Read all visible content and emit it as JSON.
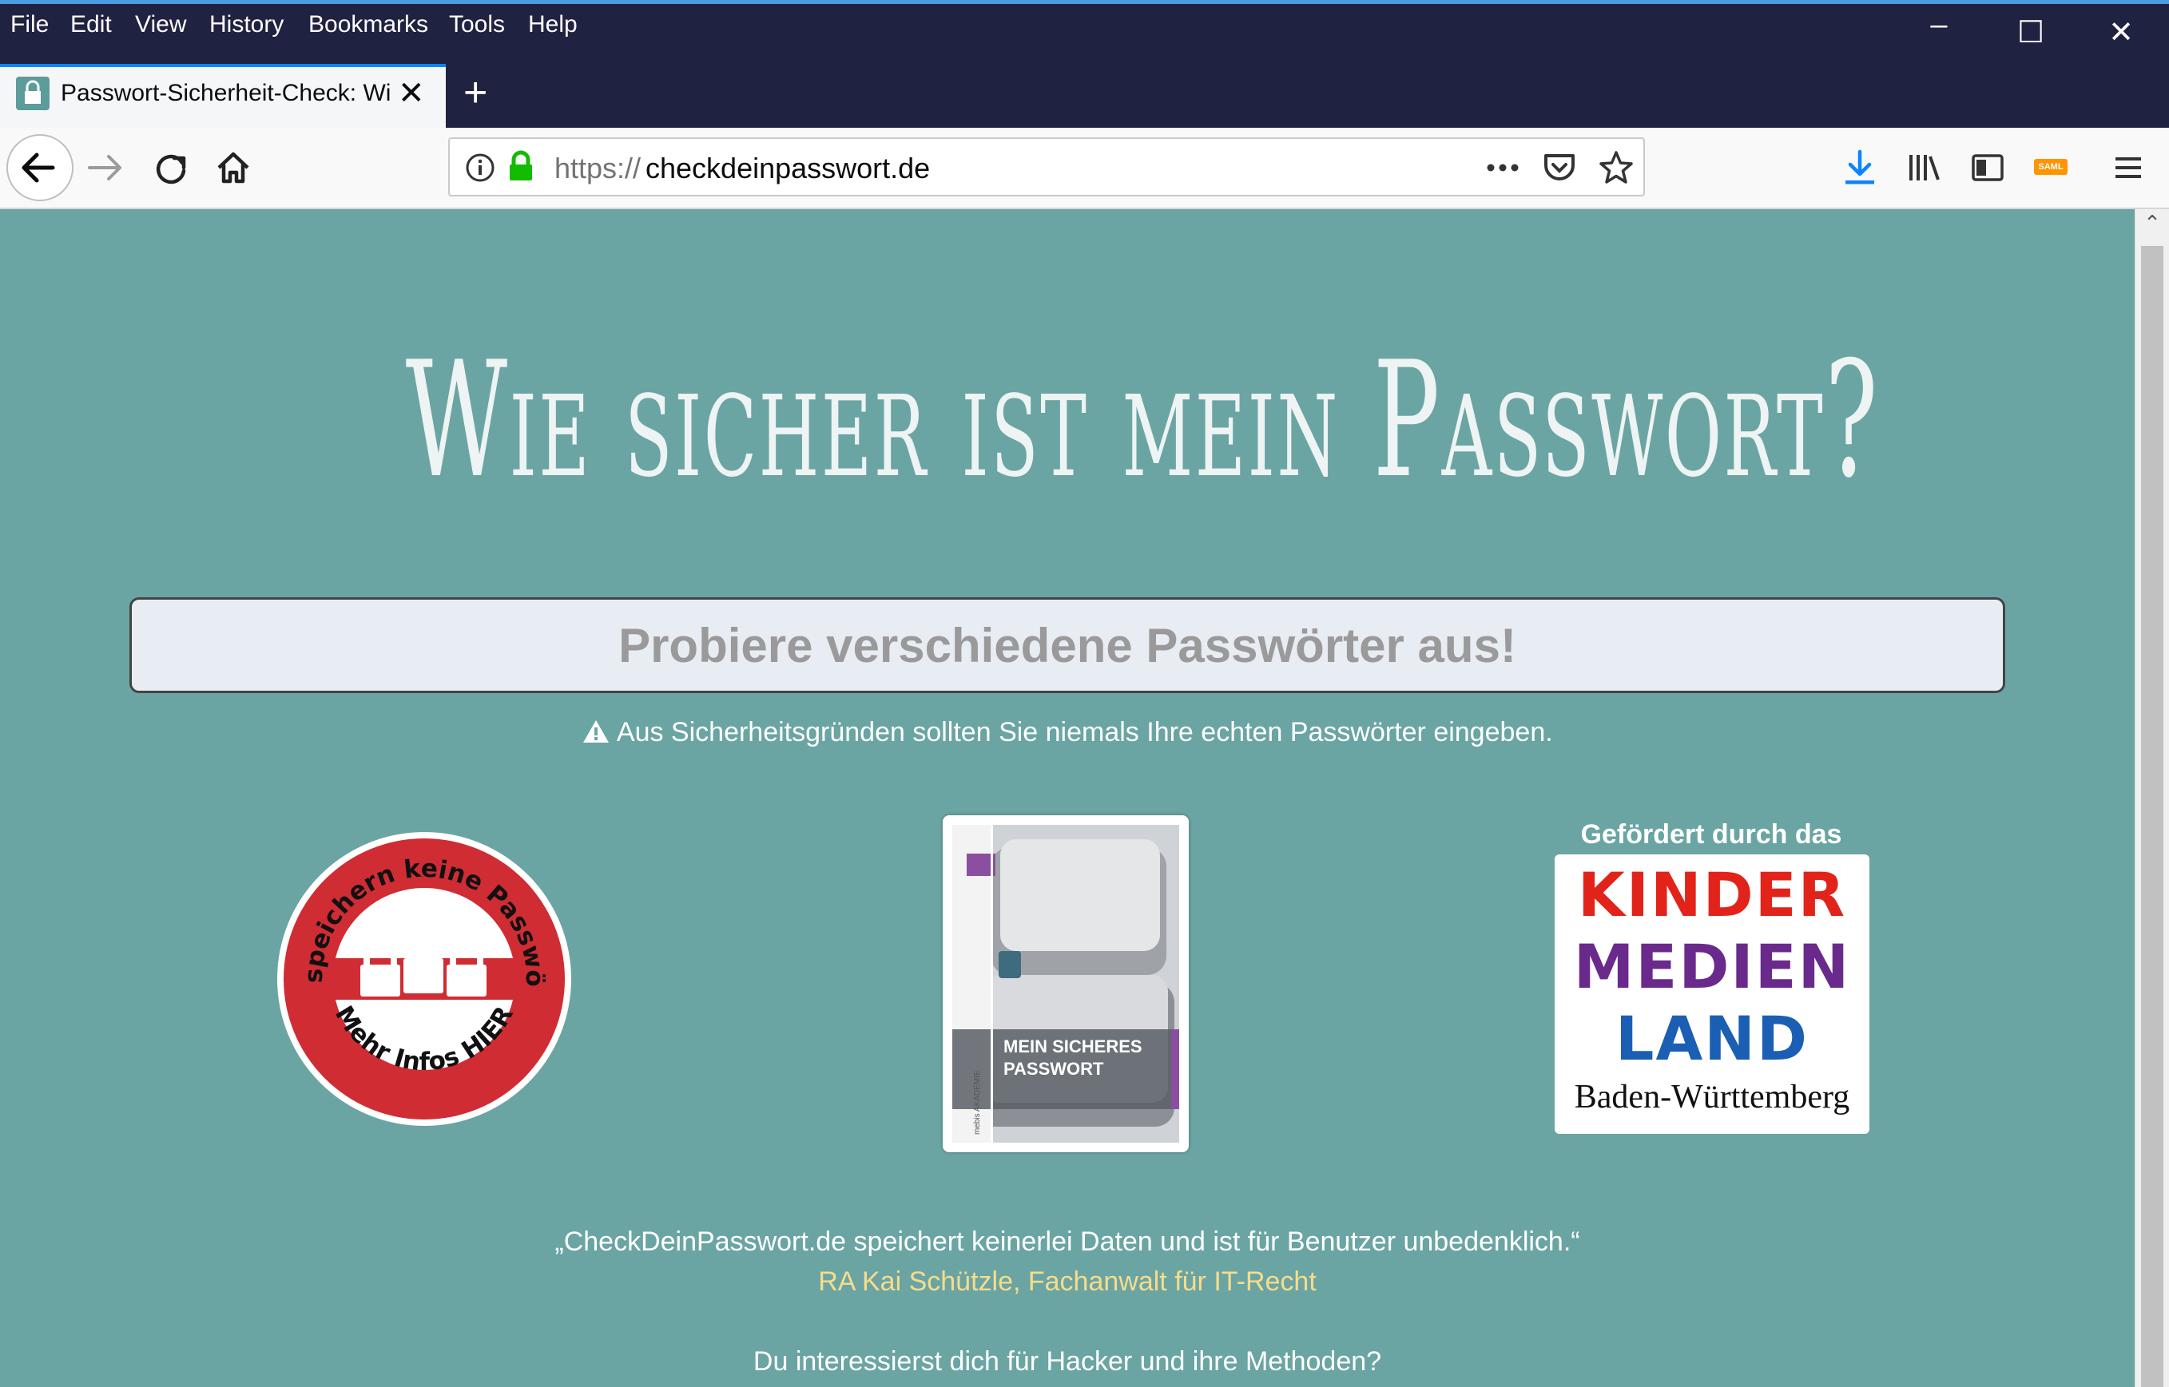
{
  "browser": {
    "menu": [
      "File",
      "Edit",
      "View",
      "History",
      "Bookmarks",
      "Tools",
      "Help"
    ],
    "window_controls": {
      "minimize": "–",
      "maximize": "☐",
      "close": "✕"
    },
    "tab_title": "Passwort-Sicherheit-Check: Wie sicher ist mein Passwort?",
    "url_protocol": "https://",
    "url_host": "checkdeinpasswort.de",
    "toolbar_icons": [
      "back-icon",
      "forward-icon",
      "reload-icon",
      "home-icon",
      "info-icon",
      "lock-icon",
      "more-icon",
      "pocket-icon",
      "star-icon",
      "download-icon",
      "library-icon",
      "sidebar-icon",
      "saml-icon",
      "menu-icon"
    ],
    "saml_label": "SAML"
  },
  "page": {
    "title": "Wie sicher ist mein Passwort?",
    "input_placeholder": "Probiere verschiedene Passwörter aus!",
    "warning": "Aus Sicherheitsgründen sollten Sie niemals Ihre echten Passwörter eingeben.",
    "badge": {
      "top_text": "Wir speichern keine Passwörter",
      "bottom_text": "Mehr Infos HIER"
    },
    "book": {
      "title_line1": "MEIN SICHERES",
      "title_line2": "PASSWORT",
      "spine": "mebis AKADEMIE"
    },
    "sponsor_label": "Gefördert durch das",
    "sponsor_logo": {
      "line1": "KINDER",
      "line2": "MEDIEN",
      "line3": "LAND",
      "line4": "Baden-Württemberg"
    },
    "quote": "„CheckDeinPasswort.de speichert keinerlei Daten und ist für Benutzer unbedenklich.“",
    "quote_author": "RA Kai Schützle, Fachanwalt für IT-Recht",
    "hacker_text": "Du interessierst dich für Hacker und ihre Methoden?"
  },
  "colors": {
    "page_bg": "#6aa5a3",
    "titlebar": "#1f2241",
    "badge_red": "#d02c33",
    "author": "#f7dc8c",
    "download_blue": "#0a84ff"
  }
}
